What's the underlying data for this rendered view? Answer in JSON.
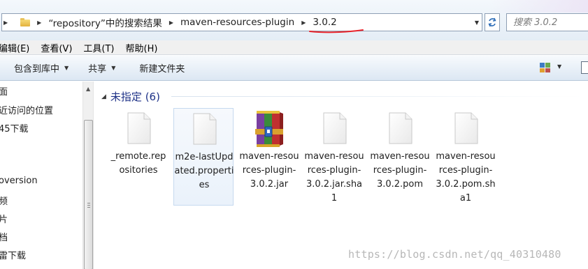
{
  "address_bar": {
    "crumbs": [
      "“repository”中的搜索结果",
      "maven-resources-plugin",
      "3.0.2"
    ],
    "search_placeholder": "搜索 3.0.2"
  },
  "menu": [
    "编辑(E)",
    "查看(V)",
    "工具(T)",
    "帮助(H)"
  ],
  "toolbar": {
    "include_library": "包含到库中",
    "share": "共享",
    "new_folder": "新建文件夹"
  },
  "nav_pane": {
    "items": [
      "面",
      "近访问的位置",
      "45下载",
      "oversion",
      "频",
      "片",
      "档",
      "雷下载"
    ]
  },
  "content": {
    "group_title": "未指定 (6)",
    "files": [
      {
        "name": "_remote.repositories",
        "icon": "document-icon",
        "selected": false
      },
      {
        "name": "m2e-lastUpdated.properties",
        "icon": "document-icon",
        "selected": true
      },
      {
        "name": "maven-resources-plugin-3.0.2.jar",
        "icon": "winrar-archive-icon",
        "selected": false
      },
      {
        "name": "maven-resources-plugin-3.0.2.jar.sha1",
        "icon": "document-icon",
        "selected": false
      },
      {
        "name": "maven-resources-plugin-3.0.2.pom",
        "icon": "document-icon",
        "selected": false
      },
      {
        "name": "maven-resources-plugin-3.0.2.pom.sha1",
        "icon": "document-icon",
        "selected": false
      }
    ]
  },
  "watermark": "https://blog.csdn.net/qq_40310480",
  "colors": {
    "group_title": "#1e3287",
    "annotation_red": "#e8222a",
    "selection_border": "#c6d9ef"
  }
}
